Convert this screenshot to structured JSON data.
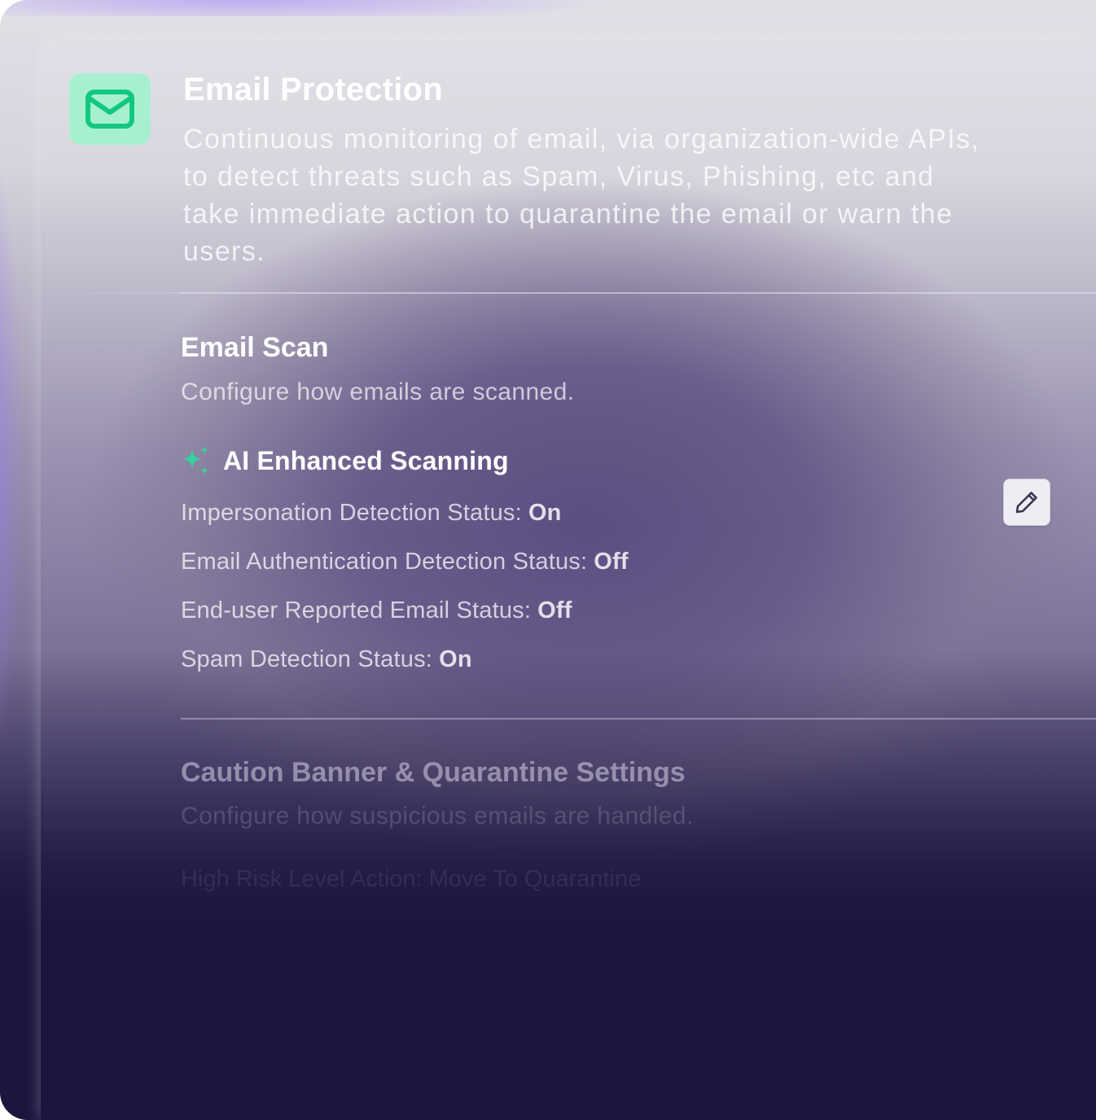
{
  "header": {
    "icon": "mail-icon",
    "title": "Email Protection",
    "description": "Continuous monitoring of email, via organization-wide APIs, to detect threats such as Spam, Virus, Phishing, etc and take immediate action to quarantine the email or warn the users."
  },
  "email_scan": {
    "title": "Email Scan",
    "subtitle": "Configure how emails are scanned.",
    "ai_icon": "sparkles-icon",
    "ai_label": "AI Enhanced Scanning",
    "edit_icon": "pencil-icon",
    "statuses": [
      {
        "label": "Impersonation Detection Status:",
        "value": "On"
      },
      {
        "label": "Email Authentication Detection Status:",
        "value": "Off"
      },
      {
        "label": "End-user Reported Email Status:",
        "value": "Off"
      },
      {
        "label": "Spam Detection Status:",
        "value": "On"
      }
    ]
  },
  "caution_banner": {
    "title": "Caution Banner & Quarantine Settings",
    "subtitle": "Configure how suspicious emails are handled.",
    "first_row": "High Risk Level Action: Move To Quarantine"
  },
  "colors": {
    "accent_green": "#2fd89a",
    "icon_tile": "#a7f0cf",
    "background_dark": "#1c153e"
  }
}
